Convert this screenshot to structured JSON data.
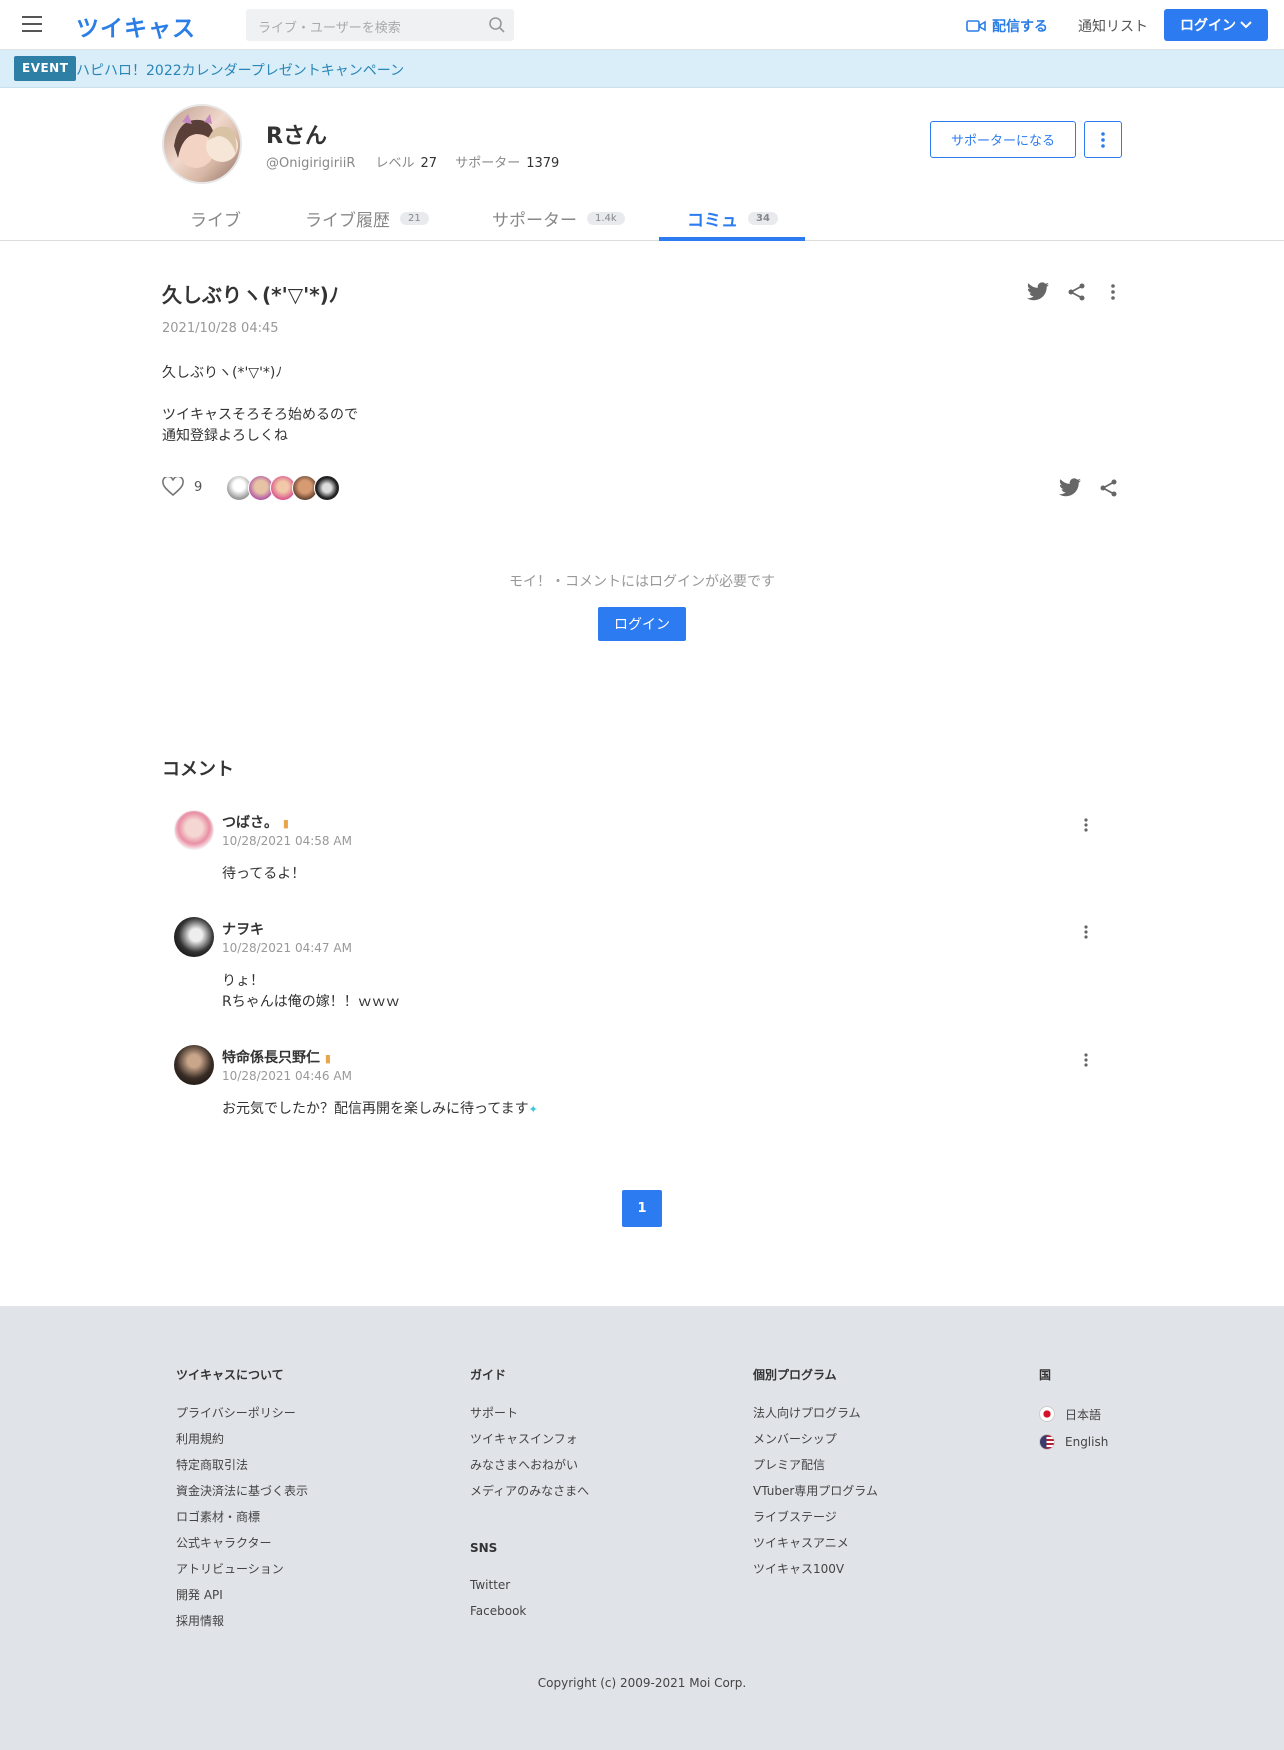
{
  "header": {
    "logo": "ツイキャス",
    "search_placeholder": "ライブ・ユーザーを検索",
    "broadcast_label": "配信する",
    "notif_label": "通知リスト",
    "login_label": "ログイン"
  },
  "event": {
    "badge": "EVENT",
    "text": "ハピハロ！2022カレンダープレゼントキャンペーン"
  },
  "profile": {
    "name": "Rさん",
    "handle": "@OnigirigiriiR",
    "level_label": "レベル",
    "level_value": "27",
    "supporter_label": "サポーター",
    "supporter_value": "1379",
    "supporter_button": "サポーターになる"
  },
  "tabs": [
    {
      "label": "ライブ",
      "badge": ""
    },
    {
      "label": "ライブ履歴",
      "badge": "21"
    },
    {
      "label": "サポーター",
      "badge": "1.4k"
    },
    {
      "label": "コミュ",
      "badge": "34"
    }
  ],
  "post": {
    "title": "久しぶりヽ(*'▽'*)ﾉ",
    "date": "2021/10/28 04:45",
    "body_lines": [
      "久しぶりヽ(*'▽'*)ﾉ",
      "",
      "ツイキャスそろそろ始めるので",
      "通知登録よろしくね"
    ],
    "moi_count": "9",
    "login_note": "モイ！・コメントにはログインが必要です",
    "login_button": "ログイン"
  },
  "comments_heading": "コメント",
  "comments": [
    {
      "name": "つばさ。",
      "time": "10/28/2021 04:58 AM",
      "text_lines": [
        "待ってるよ！"
      ]
    },
    {
      "name": "ナヲキ",
      "time": "10/28/2021 04:47 AM",
      "text_lines": [
        "りょ！",
        "Rちゃんは俺の嫁！！ｗｗｗ"
      ]
    },
    {
      "name": "特命係長只野仁",
      "time": "10/28/2021 04:46 AM",
      "text_lines": [
        "お元気でしたか？配信再開を楽しみに待ってます"
      ]
    }
  ],
  "pagination": {
    "current": "1"
  },
  "footer": {
    "col1": {
      "title": "ツイキャスについて",
      "links": [
        "プライバシーポリシー",
        "利用規約",
        "特定商取引法",
        "資金決済法に基づく表示",
        "ロゴ素材・商標",
        "公式キャラクター",
        "アトリビューション",
        "開発 API",
        "採用情報"
      ]
    },
    "col2": {
      "title": "ガイド",
      "links": [
        "サポート",
        "ツイキャスインフォ",
        "みなさまへおねがい",
        "メディアのみなさまへ"
      ]
    },
    "col2b": {
      "title": "SNS",
      "links": [
        "Twitter",
        "Facebook"
      ]
    },
    "col3": {
      "title": "個別プログラム",
      "links": [
        "法人向けプログラム",
        "メンバーシップ",
        "プレミア配信",
        "VTuber専用プログラム",
        "ライブステージ",
        "ツイキャスアニメ",
        "ツイキャス100V"
      ]
    },
    "col4": {
      "title": "国",
      "langs": [
        "日本語",
        "English"
      ]
    },
    "copyright": "Copyright (c) 2009-2021 Moi Corp."
  },
  "colors": {
    "accent": "#2d7bf0",
    "footer_bg": "#e0e3e8",
    "event_bg": "#d9eef8"
  }
}
